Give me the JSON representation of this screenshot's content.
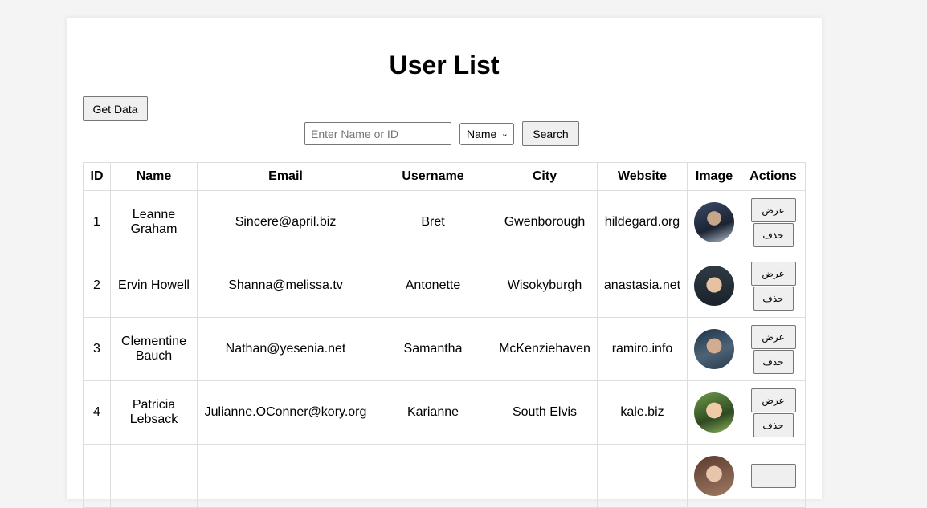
{
  "page": {
    "title": "User List",
    "get_data_label": "Get Data",
    "search_placeholder": "Enter Name or ID",
    "filter_selected": "Name",
    "search_label": "Search"
  },
  "table": {
    "headers": [
      "ID",
      "Name",
      "Email",
      "Username",
      "City",
      "Website",
      "Image",
      "Actions"
    ],
    "rows": [
      {
        "id": "1",
        "name": "Leanne Graham",
        "email": "Sincere@april.biz",
        "username": "Bret",
        "city": "Gwenborough",
        "website": "hildegard.org",
        "view_label": "عرض",
        "delete_label": "حذف"
      },
      {
        "id": "2",
        "name": "Ervin Howell",
        "email": "Shanna@melissa.tv",
        "username": "Antonette",
        "city": "Wisokyburgh",
        "website": "anastasia.net",
        "view_label": "عرض",
        "delete_label": "حذف"
      },
      {
        "id": "3",
        "name": "Clementine Bauch",
        "email": "Nathan@yesenia.net",
        "username": "Samantha",
        "city": "McKenziehaven",
        "website": "ramiro.info",
        "view_label": "عرض",
        "delete_label": "حذف"
      },
      {
        "id": "4",
        "name": "Patricia Lebsack",
        "email": "Julianne.OConner@kory.org",
        "username": "Karianne",
        "city": "South Elvis",
        "website": "kale.biz",
        "view_label": "عرض",
        "delete_label": "حذف"
      },
      {
        "id": "",
        "name": "",
        "email": "",
        "username": "",
        "city": "",
        "website": "",
        "view_label": "",
        "delete_label": ""
      }
    ]
  },
  "colors": {
    "page_bg": "#f4f4f4",
    "card_bg": "#ffffff",
    "border": "#dddddd",
    "button_bg": "#efefef"
  },
  "avatar_icons": [
    "user-photo-icon",
    "user-photo-icon",
    "user-photo-icon",
    "user-photo-icon",
    "user-photo-icon"
  ]
}
